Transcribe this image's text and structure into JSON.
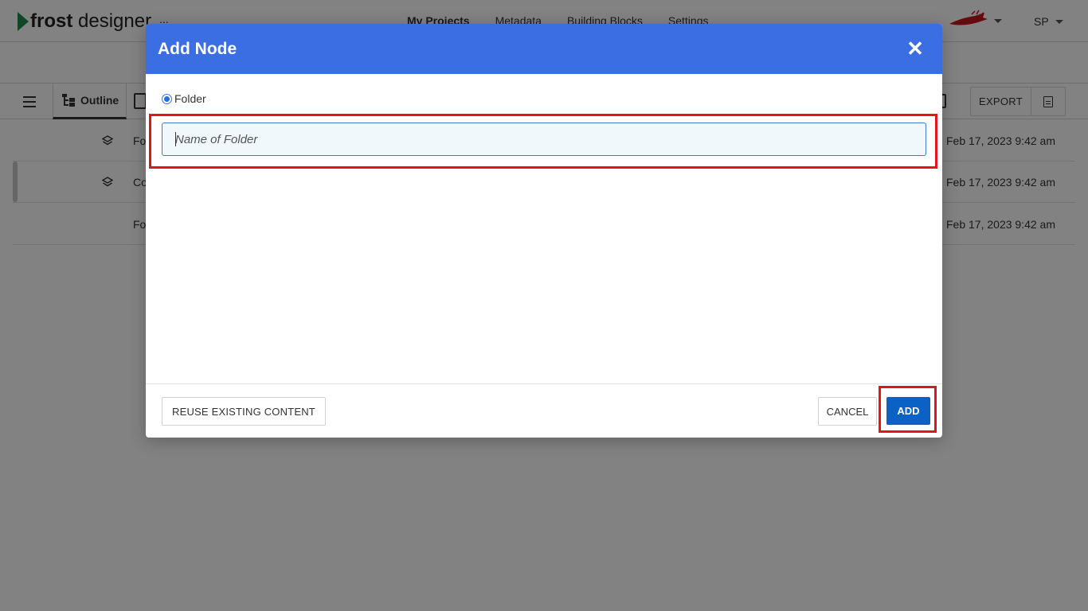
{
  "app": {
    "logo_bold": "frost",
    "logo_rest": " designer",
    "ellipsis": "...",
    "nav": [
      "My Projects",
      "Metadata",
      "Building Blocks",
      "Settings"
    ],
    "user_initials": "SP"
  },
  "toolbar": {
    "outline_label": "Outline",
    "export_label": "EXPORT"
  },
  "rows": [
    {
      "name": "Fo",
      "date": "Feb 17, 2023 9:42 am",
      "icon": "layers-icon"
    },
    {
      "name": "Co",
      "date": "Feb 17, 2023 9:42 am",
      "icon": "layers-icon"
    },
    {
      "name": "Fo",
      "date": "Feb 17, 2023 9:42 am",
      "icon": ""
    }
  ],
  "modal": {
    "title": "Add Node",
    "close_glyph": "✕",
    "radio_label": "Folder",
    "input_value": "",
    "input_placeholder": "Name of Folder",
    "reuse_label": "REUSE EXISTING CONTENT",
    "cancel_label": "CANCEL",
    "add_label": "ADD"
  },
  "colors": {
    "modal_header": "#3c6ee3",
    "primary_button": "#0b62c4",
    "highlight": "#e0161b",
    "logo_accent": "#1f8a4c"
  }
}
